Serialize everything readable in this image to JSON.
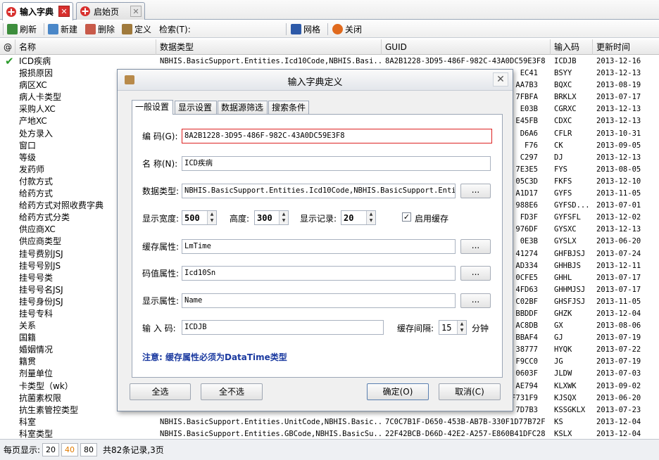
{
  "tabs": [
    {
      "label": "输入字典",
      "active": true
    },
    {
      "label": "启始页",
      "active": false
    }
  ],
  "toolbar": {
    "refresh": "刷新",
    "new": "新建",
    "delete": "删除",
    "define": "定义",
    "search_label": "检索(T):",
    "grid": "网格",
    "close": "关闭"
  },
  "grid": {
    "headers": {
      "flag": "@",
      "name": "名称",
      "type": "数据类型",
      "guid": "GUID",
      "code": "输入码",
      "time": "更新时间"
    },
    "rows": [
      {
        "name": "ICD疾病",
        "type": "NBHIS.BasicSupport.Entities.Icd10Code,NBHIS.Basi...",
        "guid": "8A2B1228-3D95-486F-982C-43A0DC59E3F8",
        "code": "ICDJB",
        "time": "2013-12-16"
      },
      {
        "name": "报损原因",
        "type": "",
        "guid": "EC41",
        "code": "BSYY",
        "time": "2013-12-13"
      },
      {
        "name": "病区XC",
        "type": "",
        "guid": "AA7B3",
        "code": "BQXC",
        "time": "2013-08-19"
      },
      {
        "name": "病人卡类型",
        "type": "",
        "guid": "7FBFA",
        "code": "BRKLX",
        "time": "2013-07-17"
      },
      {
        "name": "采购人XC",
        "type": "",
        "guid": "E03B",
        "code": "CGRXC",
        "time": "2013-12-13"
      },
      {
        "name": "产地XC",
        "type": "",
        "guid": "E45FB",
        "code": "CDXC",
        "time": "2013-12-13"
      },
      {
        "name": "处方录入",
        "type": "",
        "guid": "D6A6",
        "code": "CFLR",
        "time": "2013-10-31"
      },
      {
        "name": "窗口",
        "type": "",
        "guid": "F76",
        "code": "CK",
        "time": "2013-09-05"
      },
      {
        "name": "等级",
        "type": "",
        "guid": "C297",
        "code": "DJ",
        "time": "2013-12-13"
      },
      {
        "name": "发药师",
        "type": "",
        "guid": "7E3E5",
        "code": "FYS",
        "time": "2013-08-05"
      },
      {
        "name": "付款方式",
        "type": "",
        "guid": "05C3D",
        "code": "FKFS",
        "time": "2013-12-10"
      },
      {
        "name": "给药方式",
        "type": "",
        "guid": "A1D17",
        "code": "GYFS",
        "time": "2013-11-05"
      },
      {
        "name": "给药方式对照收费字典",
        "type": "",
        "guid": "988E6",
        "code": "GYFSD...",
        "time": "2013-07-01"
      },
      {
        "name": "给药方式分类",
        "type": "",
        "guid": "FD3F",
        "code": "GYFSFL",
        "time": "2013-12-02"
      },
      {
        "name": "供应商XC",
        "type": "",
        "guid": "976DF",
        "code": "GYSXC",
        "time": "2013-12-13"
      },
      {
        "name": "供应商类型",
        "type": "",
        "guid": "0E3B",
        "code": "GYSLX",
        "time": "2013-06-20"
      },
      {
        "name": "挂号费别JSJ",
        "type": "",
        "guid": "41274",
        "code": "GHFBJSJ",
        "time": "2013-07-24"
      },
      {
        "name": "挂号号别JS",
        "type": "",
        "guid": "AD334",
        "code": "GHHBJS",
        "time": "2013-12-11"
      },
      {
        "name": "挂号号类",
        "type": "",
        "guid": "0CFE5",
        "code": "GHHL",
        "time": "2013-07-17"
      },
      {
        "name": "挂号号名JSJ",
        "type": "",
        "guid": "4FD63",
        "code": "GHHMJSJ",
        "time": "2013-07-17"
      },
      {
        "name": "挂号身份JSJ",
        "type": "",
        "guid": "C02BF",
        "code": "GHSFJSJ",
        "time": "2013-11-05"
      },
      {
        "name": "挂号专科",
        "type": "",
        "guid": "BBDDF",
        "code": "GHZK",
        "time": "2013-12-04"
      },
      {
        "name": "关系",
        "type": "",
        "guid": "AC8DB",
        "code": "GX",
        "time": "2013-08-06"
      },
      {
        "name": "国籍",
        "type": "",
        "guid": "BBAF4",
        "code": "GJ",
        "time": "2013-07-19"
      },
      {
        "name": "婚姻情况",
        "type": "",
        "guid": "38777",
        "code": "HYQK",
        "time": "2013-07-22"
      },
      {
        "name": "籍贯",
        "type": "",
        "guid": "F9CC0",
        "code": "JG",
        "time": "2013-07-19"
      },
      {
        "name": "剂量单位",
        "type": "",
        "guid": "0603F",
        "code": "JLDW",
        "time": "2013-07-03"
      },
      {
        "name": "卡类型（wk）",
        "type": "",
        "guid": "AE794",
        "code": "KLXWK",
        "time": "2013-09-02"
      },
      {
        "name": "抗菌素权限",
        "type": "",
        "guid": "F731F9",
        "code": "KJSQX",
        "time": "2013-06-20"
      },
      {
        "name": "抗生素管控类型",
        "type": "",
        "guid": "7D7B3",
        "code": "KSSGKLX",
        "time": "2013-07-23"
      },
      {
        "name": "科室",
        "type": "NBHIS.BasicSupport.Entities.UnitCode,NBHIS.Basic...",
        "guid": "7C0C7B1F-D650-453B-AB7B-330F1D77B72F",
        "code": "KS",
        "time": "2013-12-04"
      },
      {
        "name": "科室类型",
        "type": "NBHIS.BasicSupport.Entities.GBCode,NBHIS.BasicSu...",
        "guid": "22F42BCB-D66D-42E2-A257-E860B41DFC28",
        "code": "KSLX",
        "time": "2013-12-04"
      }
    ]
  },
  "status": {
    "per_page_label": "每页显示:",
    "options": [
      "20",
      "40",
      "80"
    ],
    "selected": "40",
    "summary": "共82条记录,3页"
  },
  "dialog": {
    "title": "输入字典定义",
    "tabs": [
      "一般设置",
      "显示设置",
      "数据源筛选",
      "搜索条件"
    ],
    "code_label": "编 码(G):",
    "code_value": "8A2B1228-3D95-486F-982C-43A0DC59E3F8",
    "name_label": "名 称(N):",
    "name_value": "ICD疾病",
    "type_label": "数据类型:",
    "type_value": "NBHIS.BasicSupport.Entities.Icd10Code,NBHIS.BasicSupport.Entitie",
    "ellipsis": "...",
    "width_label": "显示宽度:",
    "width_value": "500",
    "height_label": "高度:",
    "height_value": "300",
    "records_label": "显示记录:",
    "records_value": "20",
    "cache_label": "启用缓存",
    "cache_checked": "✓",
    "cache_attr_label": "缓存属性:",
    "cache_attr_value": "LmTime",
    "value_attr_label": "码值属性:",
    "value_attr_value": "Icd10Sn",
    "display_attr_label": "显示属性:",
    "display_attr_value": "Name",
    "input_code_label": "输 入 码:",
    "input_code_value": "ICDJB",
    "interval_label": "缓存间隔:",
    "interval_value": "15",
    "interval_unit": "分钟",
    "note": "注意: 缓存属性必须为DataTime类型",
    "btn_select_all": "全选",
    "btn_select_none": "全不选",
    "btn_ok": "确定(O)",
    "btn_cancel": "取消(C)"
  }
}
